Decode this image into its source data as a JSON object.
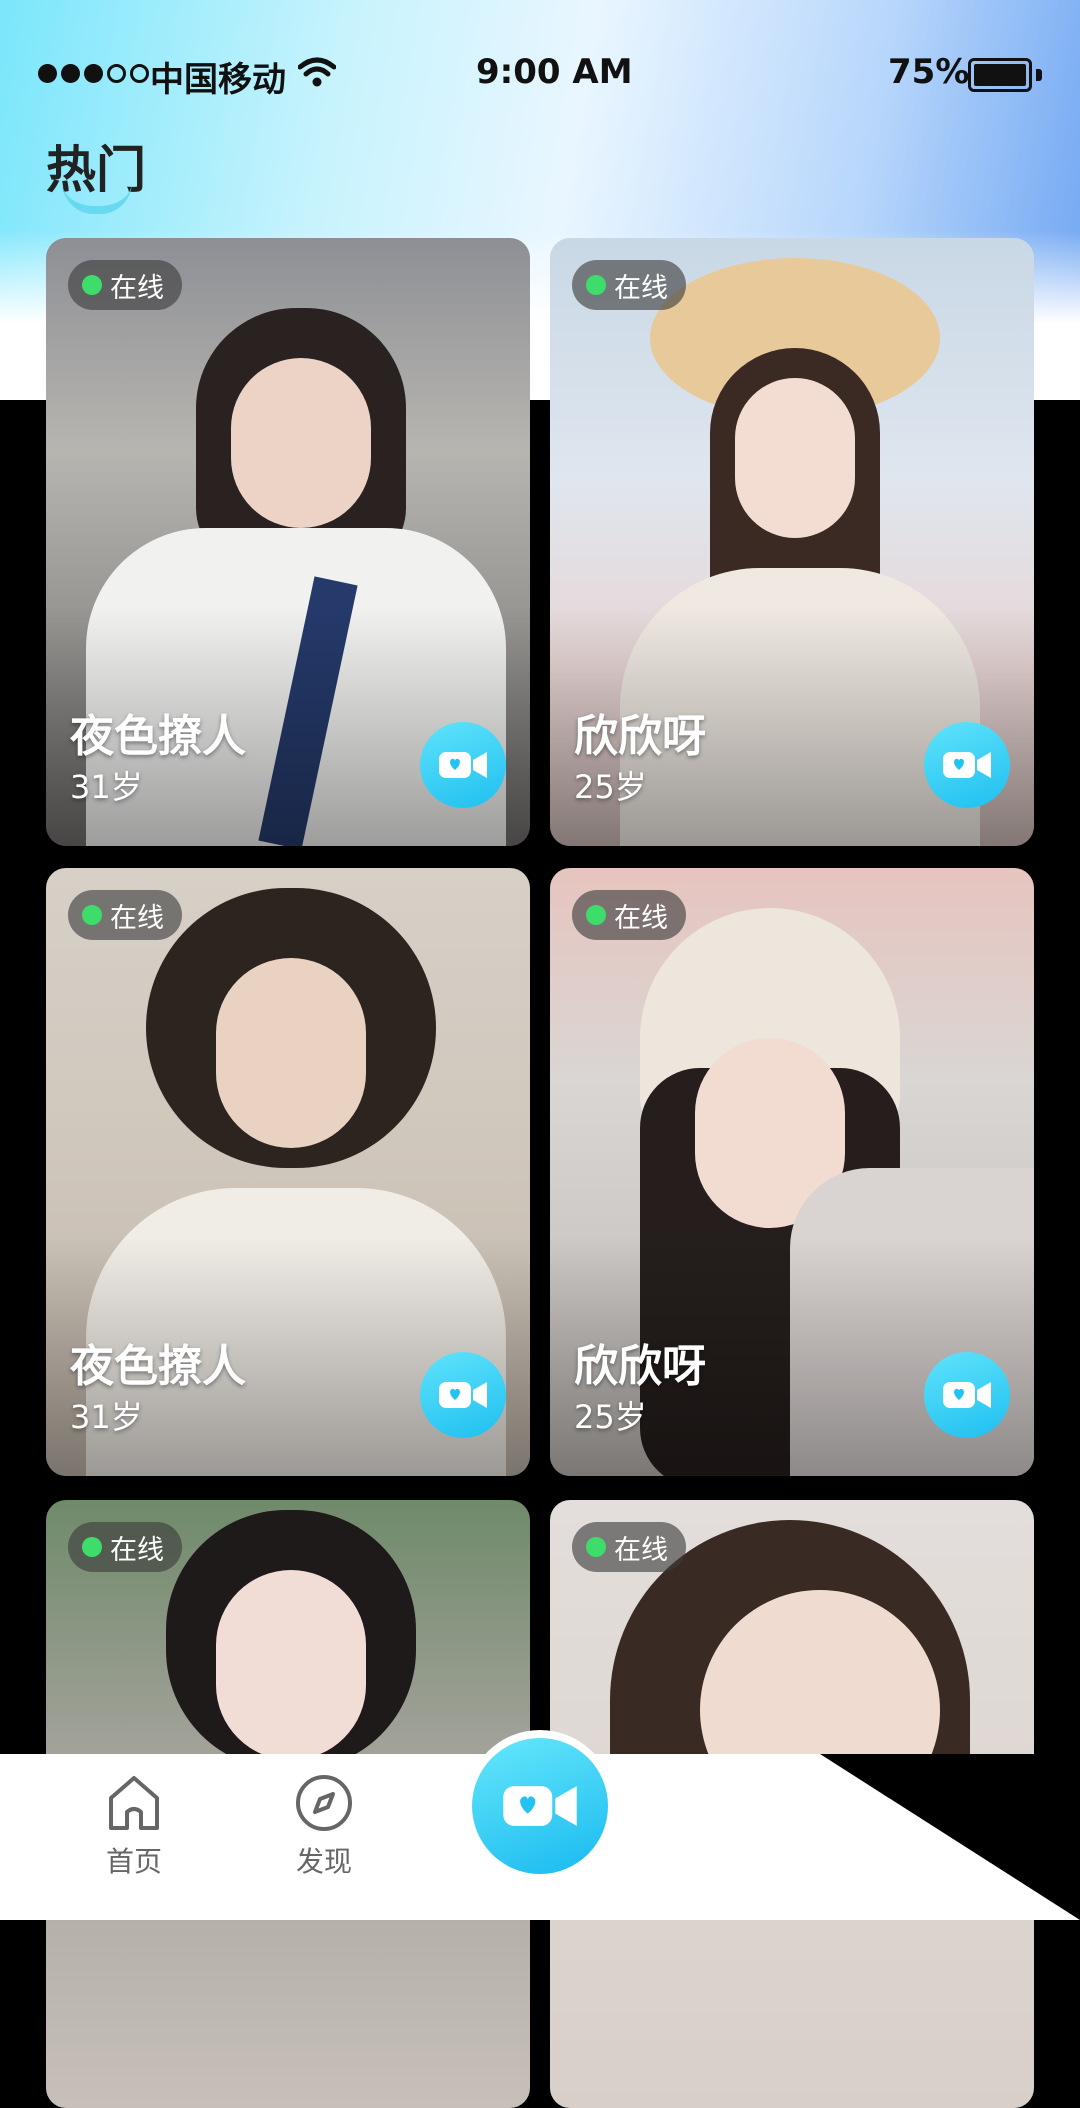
{
  "status_bar": {
    "carrier": "中国移动",
    "time": "9:00 AM",
    "battery": "75%"
  },
  "section": {
    "title": "热门"
  },
  "badge": {
    "online": "在线"
  },
  "cards": [
    {
      "name": "夜色撩人",
      "age": "31岁"
    },
    {
      "name": "欣欣呀",
      "age": "25岁"
    },
    {
      "name": "夜色撩人",
      "age": "31岁"
    },
    {
      "name": "欣欣呀",
      "age": "25岁"
    },
    {
      "name": "",
      "age": ""
    },
    {
      "name": "",
      "age": ""
    }
  ],
  "tab_bar": {
    "home": "首页",
    "discover": "发现"
  },
  "colors": {
    "accent": "#22c3f2",
    "online": "#3ddc6b"
  },
  "icons": [
    "wifi-icon",
    "battery-icon",
    "video-call-icon",
    "home-icon",
    "compass-icon"
  ]
}
